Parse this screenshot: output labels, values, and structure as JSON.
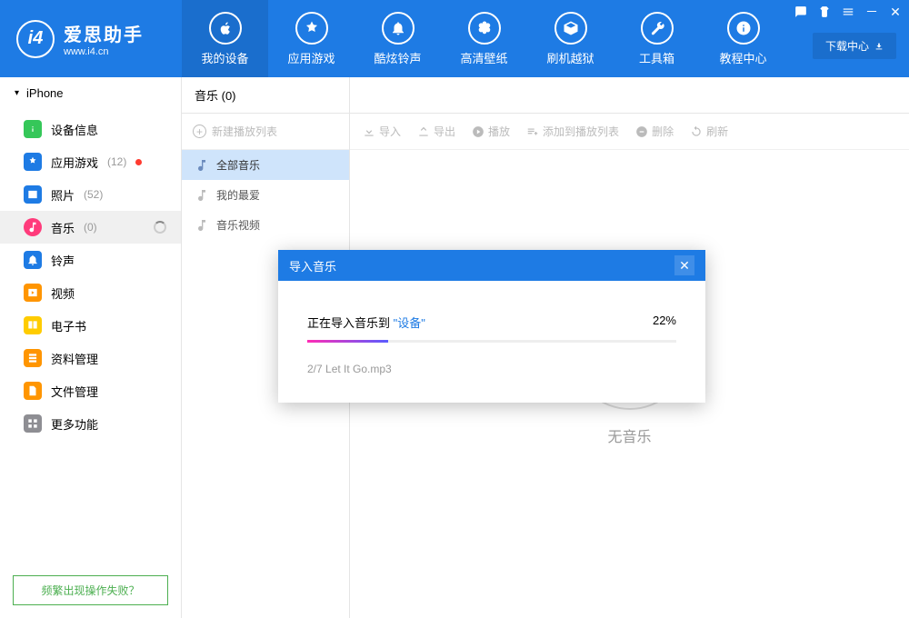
{
  "logo": {
    "mark": "i4",
    "title": "爱思助手",
    "subtitle": "www.i4.cn"
  },
  "nav": [
    {
      "label": "我的设备"
    },
    {
      "label": "应用游戏"
    },
    {
      "label": "酷炫铃声"
    },
    {
      "label": "高清壁纸"
    },
    {
      "label": "刷机越狱"
    },
    {
      "label": "工具箱"
    },
    {
      "label": "教程中心"
    }
  ],
  "download_center": "下载中心",
  "device_name": "iPhone",
  "sidebar": [
    {
      "label": "设备信息",
      "count": ""
    },
    {
      "label": "应用游戏",
      "count": "(12)"
    },
    {
      "label": "照片",
      "count": "(52)"
    },
    {
      "label": "音乐",
      "count": "(0)"
    },
    {
      "label": "铃声",
      "count": ""
    },
    {
      "label": "视频",
      "count": ""
    },
    {
      "label": "电子书",
      "count": ""
    },
    {
      "label": "资料管理",
      "count": ""
    },
    {
      "label": "文件管理",
      "count": ""
    },
    {
      "label": "更多功能",
      "count": ""
    }
  ],
  "help_text": "频繁出现操作失败？",
  "music_tab": "音乐 (0)",
  "new_playlist": "新建播放列表",
  "categories": [
    {
      "label": "全部音乐"
    },
    {
      "label": "我的最爱"
    },
    {
      "label": "音乐视频"
    }
  ],
  "toolbar": {
    "import": "导入",
    "export": "导出",
    "play": "播放",
    "add_to_playlist": "添加到播放列表",
    "delete": "删除",
    "refresh": "刷新"
  },
  "empty_label": "无音乐",
  "dialog": {
    "title": "导入音乐",
    "msg_prefix": "正在导入音乐到",
    "device_quoted": "\"设备\"",
    "percent": "22%",
    "progress_width": "22%",
    "file_line": "2/7  Let It Go.mp3"
  }
}
